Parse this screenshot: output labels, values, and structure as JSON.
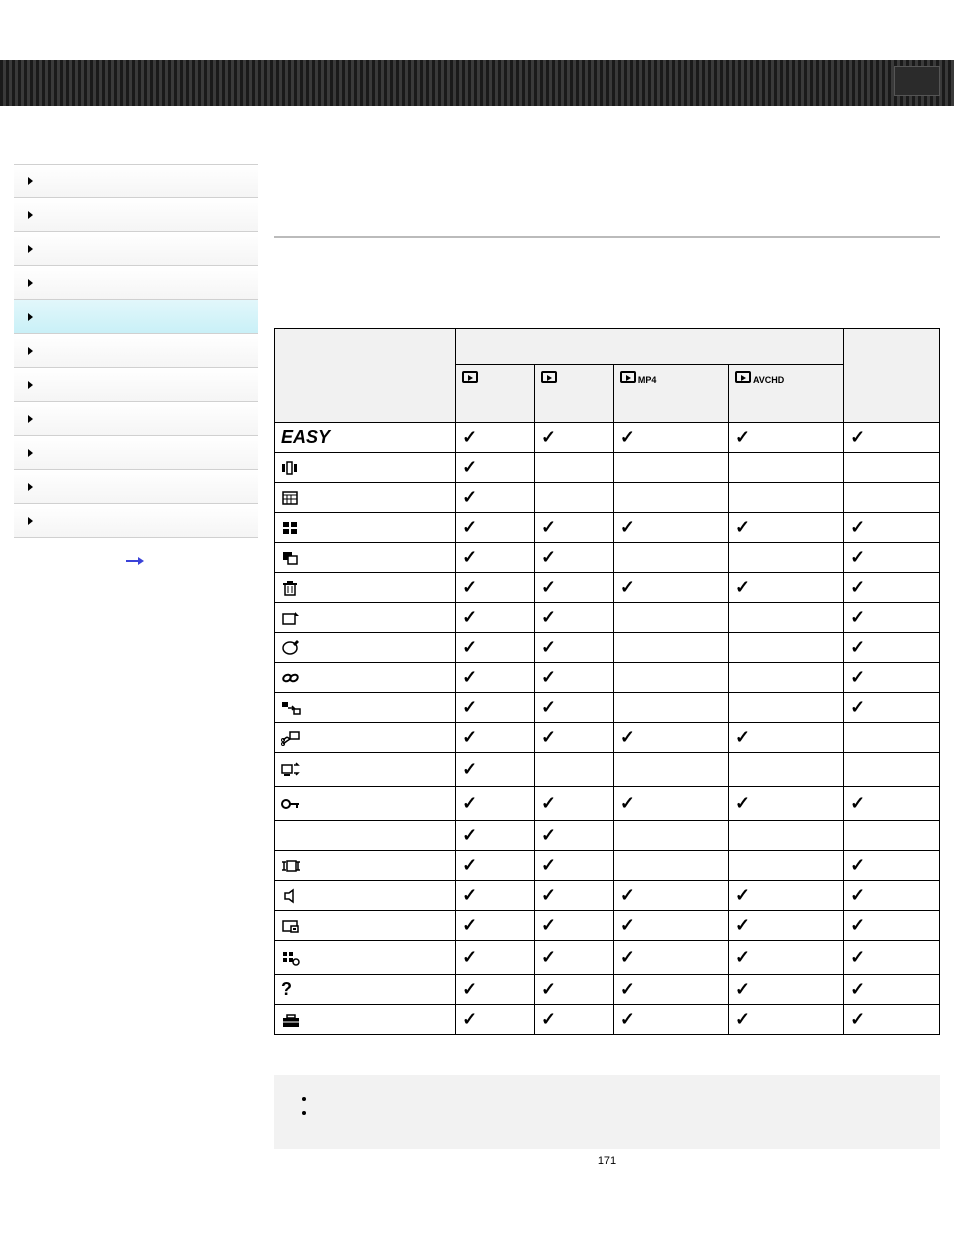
{
  "page_number": "171",
  "nav": {
    "items": [
      "",
      "",
      "",
      "",
      "",
      "",
      "",
      "",
      "",
      "",
      ""
    ],
    "selected_index": 4
  },
  "header_cols": [
    {
      "type": "play",
      "sub": ""
    },
    {
      "type": "play",
      "sub": ""
    },
    {
      "type": "play",
      "sub": "MP4"
    },
    {
      "type": "play",
      "sub": "AVCHD"
    },
    {
      "type": "blank",
      "sub": ""
    }
  ],
  "rows": [
    {
      "label_type": "text",
      "label": "EASY",
      "checks": [
        true,
        true,
        true,
        true,
        true
      ]
    },
    {
      "label_type": "icon",
      "icon": "burst-bracket",
      "checks": [
        true,
        false,
        false,
        false,
        false
      ]
    },
    {
      "label_type": "icon",
      "icon": "calendar",
      "checks": [
        true,
        false,
        false,
        false,
        false
      ]
    },
    {
      "label_type": "icon",
      "icon": "thumbnail-grid",
      "checks": [
        true,
        true,
        true,
        true,
        true
      ]
    },
    {
      "label_type": "icon",
      "icon": "copy-overlay",
      "checks": [
        true,
        true,
        false,
        false,
        true
      ]
    },
    {
      "label_type": "icon",
      "icon": "trash",
      "checks": [
        true,
        true,
        true,
        true,
        true
      ]
    },
    {
      "label_type": "icon",
      "icon": "rotate-image",
      "checks": [
        true,
        true,
        false,
        false,
        true
      ]
    },
    {
      "label_type": "icon",
      "icon": "retouch",
      "checks": [
        true,
        true,
        false,
        false,
        true
      ]
    },
    {
      "label_type": "icon",
      "icon": "location-link",
      "checks": [
        true,
        true,
        false,
        false,
        true
      ]
    },
    {
      "label_type": "icon",
      "icon": "device-transfer",
      "checks": [
        true,
        true,
        false,
        false,
        true
      ]
    },
    {
      "label_type": "icon",
      "icon": "video-divide",
      "checks": [
        true,
        true,
        true,
        true,
        false
      ]
    },
    {
      "label_type": "icon",
      "icon": "display-swap",
      "checks": [
        true,
        false,
        false,
        false,
        false
      ]
    },
    {
      "label_type": "icon",
      "icon": "protect-key",
      "checks": [
        true,
        true,
        true,
        true,
        true
      ]
    },
    {
      "label_type": "empty",
      "label": "",
      "checks": [
        true,
        true,
        false,
        false,
        false
      ]
    },
    {
      "label_type": "icon",
      "icon": "slideshow",
      "checks": [
        true,
        true,
        false,
        false,
        true
      ]
    },
    {
      "label_type": "icon",
      "icon": "speaker",
      "checks": [
        true,
        true,
        true,
        true,
        true
      ]
    },
    {
      "label_type": "icon",
      "icon": "print-order",
      "checks": [
        true,
        true,
        true,
        true,
        true
      ]
    },
    {
      "label_type": "icon",
      "icon": "grid-settings",
      "checks": [
        true,
        true,
        true,
        true,
        true
      ]
    },
    {
      "label_type": "icon",
      "icon": "question",
      "checks": [
        true,
        true,
        true,
        true,
        true
      ]
    },
    {
      "label_type": "icon",
      "icon": "toolbox",
      "checks": [
        true,
        true,
        true,
        true,
        true
      ]
    }
  ],
  "chart_data": {
    "type": "table",
    "title": "",
    "columns": [
      "mode_1",
      "mode_2",
      "MP4",
      "AVCHD",
      "column_5"
    ],
    "rows_label": [
      "EASY",
      "burst-bracket",
      "calendar",
      "thumbnail-grid",
      "copy-overlay",
      "trash",
      "rotate-image",
      "retouch",
      "location-link",
      "device-transfer",
      "video-divide",
      "display-swap",
      "protect-key",
      "(blank)",
      "slideshow",
      "speaker",
      "print-order",
      "grid-settings",
      "question",
      "toolbox"
    ],
    "values": [
      [
        1,
        1,
        1,
        1,
        1
      ],
      [
        1,
        0,
        0,
        0,
        0
      ],
      [
        1,
        0,
        0,
        0,
        0
      ],
      [
        1,
        1,
        1,
        1,
        1
      ],
      [
        1,
        1,
        0,
        0,
        1
      ],
      [
        1,
        1,
        1,
        1,
        1
      ],
      [
        1,
        1,
        0,
        0,
        1
      ],
      [
        1,
        1,
        0,
        0,
        1
      ],
      [
        1,
        1,
        0,
        0,
        1
      ],
      [
        1,
        1,
        0,
        0,
        1
      ],
      [
        1,
        1,
        1,
        1,
        0
      ],
      [
        1,
        0,
        0,
        0,
        0
      ],
      [
        1,
        1,
        1,
        1,
        1
      ],
      [
        1,
        1,
        0,
        0,
        0
      ],
      [
        1,
        1,
        0,
        0,
        1
      ],
      [
        1,
        1,
        1,
        1,
        1
      ],
      [
        1,
        1,
        1,
        1,
        1
      ],
      [
        1,
        1,
        1,
        1,
        1
      ],
      [
        1,
        1,
        1,
        1,
        1
      ],
      [
        1,
        1,
        1,
        1,
        1
      ]
    ]
  }
}
